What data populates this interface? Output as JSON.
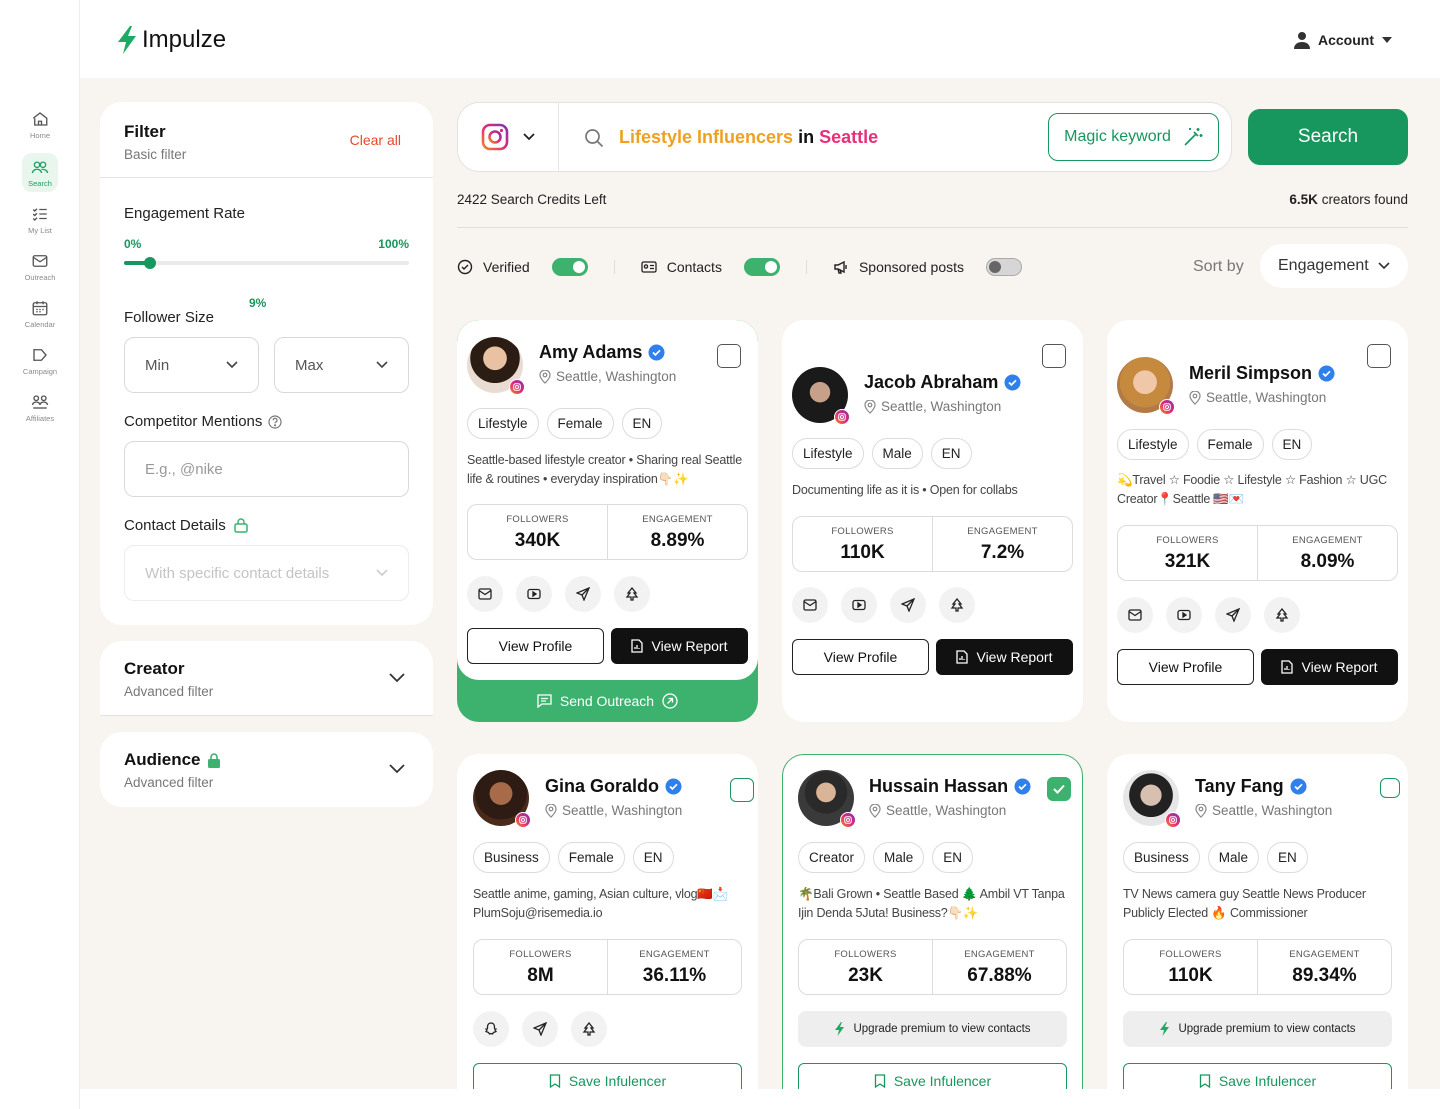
{
  "app": {
    "name": "Impulze",
    "account_label": "Account"
  },
  "sidebar": {
    "items": [
      {
        "label": "Home",
        "icon": "home-icon"
      },
      {
        "label": "Search",
        "icon": "users-search-icon"
      },
      {
        "label": "My List",
        "icon": "list-icon"
      },
      {
        "label": "Outreach",
        "icon": "mail-icon"
      },
      {
        "label": "Calendar",
        "icon": "calendar-icon"
      },
      {
        "label": "Campaign",
        "icon": "campaign-icon"
      },
      {
        "label": "Affiliates",
        "icon": "affiliates-icon"
      }
    ]
  },
  "filter": {
    "title": "Filter",
    "subtitle": "Basic filter",
    "clear_label": "Clear all",
    "engagement": {
      "label": "Engagement Rate",
      "min_label": "0%",
      "max_label": "100%",
      "value_label": "9%",
      "value": 0.09
    },
    "follower": {
      "label": "Follower Size",
      "min_placeholder": "Min",
      "max_placeholder": "Max"
    },
    "competitor": {
      "label": "Competitor Mentions",
      "placeholder": "E.g., @nike"
    },
    "contact": {
      "label": "Contact Details",
      "placeholder": "With specific contact details"
    }
  },
  "creator_panel": {
    "title": "Creator",
    "subtitle": "Advanced filter"
  },
  "audience_panel": {
    "title": "Audience",
    "subtitle": "Advanced filter"
  },
  "search": {
    "query_part1": "Lifestyle Influencers",
    "query_in": "in",
    "query_part2": "Seattle",
    "magic_label": "Magic keyword",
    "button_label": "Search",
    "credits_text": "2422 Search Credits Left",
    "found_count": "6.5K",
    "found_text": "creators found"
  },
  "toggles": [
    {
      "label": "Verified",
      "on": true
    },
    {
      "label": "Contacts",
      "on": true
    },
    {
      "label": "Sponsored posts",
      "on": false
    }
  ],
  "sort": {
    "label": "Sort by",
    "value": "Engagement"
  },
  "colors": {
    "brand_green": "#17965d",
    "accent_orange": "#f0a020",
    "accent_pink": "#e8307a",
    "verified_blue": "#2f80ed"
  },
  "labels": {
    "followers": "FOLLOWERS",
    "engagement": "ENGAGEMENT",
    "view_profile": "View Profile",
    "view_report": "View Report",
    "send_outreach": "Send Outreach",
    "upgrade": "Upgrade premium to view contacts",
    "save": "Save Infulencer"
  },
  "creators": [
    {
      "name": "Amy Adams",
      "location": "Seattle, Washington",
      "tags": [
        "Lifestyle",
        "Female",
        "EN"
      ],
      "bio": "Seattle-based lifestyle creator • Sharing real Seattle life & routines • everyday inspiration👇🏻✨",
      "followers": "340K",
      "engagement": "8.89%"
    },
    {
      "name": "Jacob Abraham",
      "location": "Seattle, Washington",
      "tags": [
        "Lifestyle",
        "Male",
        "EN"
      ],
      "bio": "Documenting life as it is • Open for collabs",
      "followers": "110K",
      "engagement": "7.2%"
    },
    {
      "name": "Meril Simpson",
      "location": "Seattle, Washington",
      "tags": [
        "Lifestyle",
        "Female",
        "EN"
      ],
      "bio": "💫Travel ☆ Foodie ☆ Lifestyle ☆ Fashion ☆ UGC Creator📍Seattle 🇺🇸💌",
      "followers": "321K",
      "engagement": "8.09%"
    },
    {
      "name": "Gina Goraldo",
      "location": "Seattle, Washington",
      "tags": [
        "Business",
        "Female",
        "EN"
      ],
      "bio": "Seattle anime, gaming, Asian culture, vlog🇨🇳📩 PlumSoju@risemedia.io",
      "followers": "8M",
      "engagement": "36.11%"
    },
    {
      "name": "Hussain Hassan",
      "location": "Seattle, Washington",
      "tags": [
        "Creator",
        "Male",
        "EN"
      ],
      "bio": "🌴Bali Grown • Seattle Based 🌲 Ambil VT Tanpa Ijin Denda 5Juta! Business?👇🏻✨",
      "followers": "23K",
      "engagement": "67.88%"
    },
    {
      "name": "Tany Fang",
      "location": "Seattle, Washington",
      "tags": [
        "Business",
        "Male",
        "EN"
      ],
      "bio": "TV News camera guy Seattle News Producer Publicly Elected 🔥 Commissioner",
      "followers": "110K",
      "engagement": "89.34%"
    }
  ]
}
